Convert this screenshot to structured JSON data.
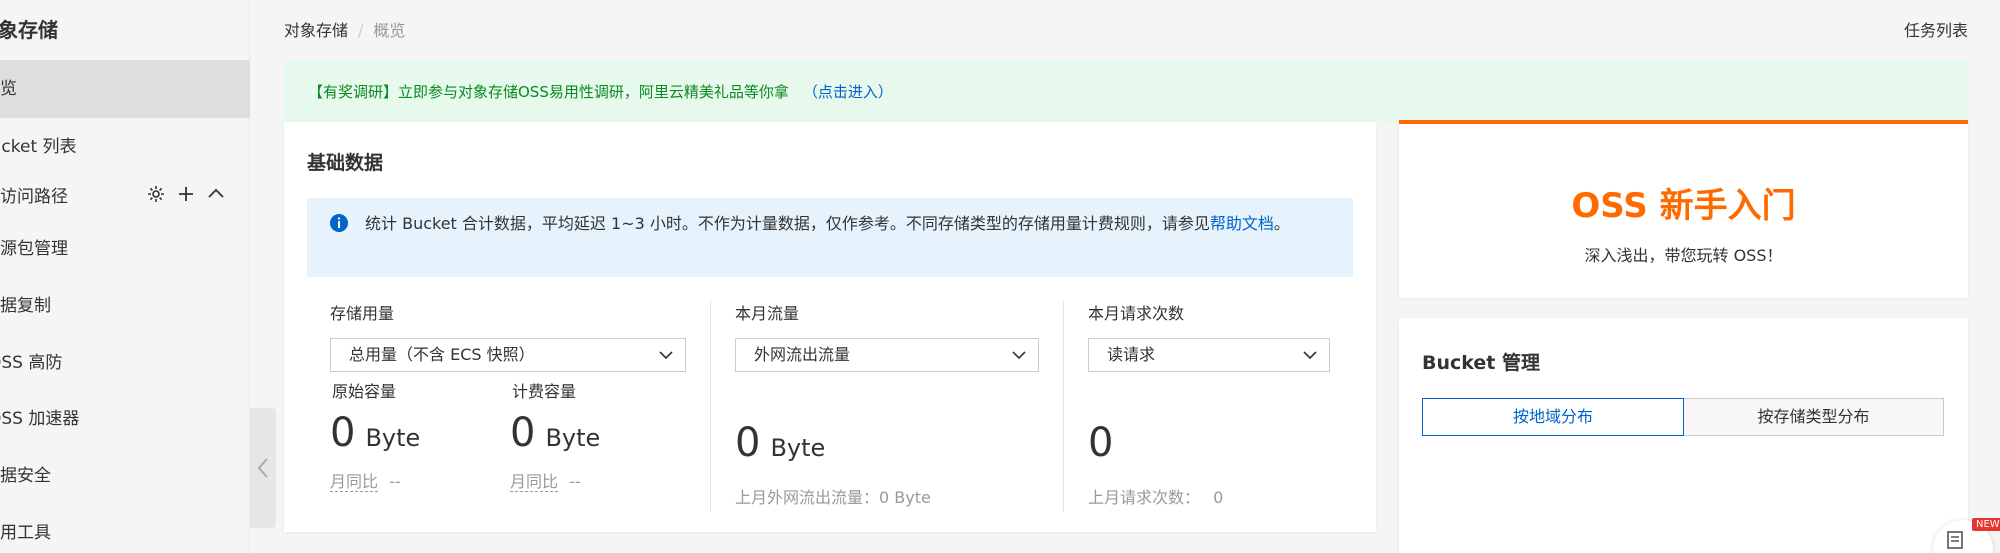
{
  "sidebar": {
    "title": "对象存储",
    "items": [
      {
        "label": "概览",
        "active": true
      },
      {
        "label": "Bucket 列表"
      },
      {
        "label": "资源包管理"
      },
      {
        "label": "数据复制"
      },
      {
        "label": "OSS 高防"
      },
      {
        "label": "OSS 加速器"
      },
      {
        "label": "数据安全"
      },
      {
        "label": "常用工具"
      }
    ],
    "group": {
      "label": "我的访问路径"
    }
  },
  "header": {
    "breadcrumb": [
      "对象存储",
      "概览"
    ],
    "task_list": "任务列表"
  },
  "banner": {
    "text": "【有奖调研】立即参与对象存储OSS易用性调研，阿里云精美礼品等你拿",
    "link": "（点击进入）"
  },
  "basic": {
    "title": "基础数据",
    "info_text": "统计 Bucket 合计数据，平均延迟 1~3 小时。不作为计量数据，仅作参考。不同存储类型的存储用量计费规则，请参见",
    "info_link": "帮助文档",
    "info_end": "。",
    "storage": {
      "label": "存储用量",
      "select": "总用量（不含 ECS 快照）",
      "original": {
        "label": "原始容量",
        "value": "0",
        "unit": "Byte",
        "yoy_label": "月同比",
        "yoy_value": "--"
      },
      "billed": {
        "label": "计费容量",
        "value": "0",
        "unit": "Byte",
        "yoy_label": "月同比",
        "yoy_value": "--"
      }
    },
    "traffic": {
      "label": "本月流量",
      "select": "外网流出流量",
      "value": "0",
      "unit": "Byte",
      "last_month": "上月外网流出流量：0 Byte"
    },
    "requests": {
      "label": "本月请求次数",
      "select": "读请求",
      "value": "0",
      "last_month_label": "上月请求次数：",
      "last_month_value": "0"
    }
  },
  "getstarted": {
    "title": "OSS 新手入门",
    "subtitle": "深入浅出，带您玩转 OSS！"
  },
  "bucket_mgmt": {
    "title": "Bucket 管理",
    "tabs": [
      "按地域分布",
      "按存储类型分布"
    ]
  },
  "badge": "NEW",
  "colors": {
    "accent": "#0064c8",
    "brand_orange": "#ff6a00",
    "banner_green": "#0a8a1f"
  }
}
